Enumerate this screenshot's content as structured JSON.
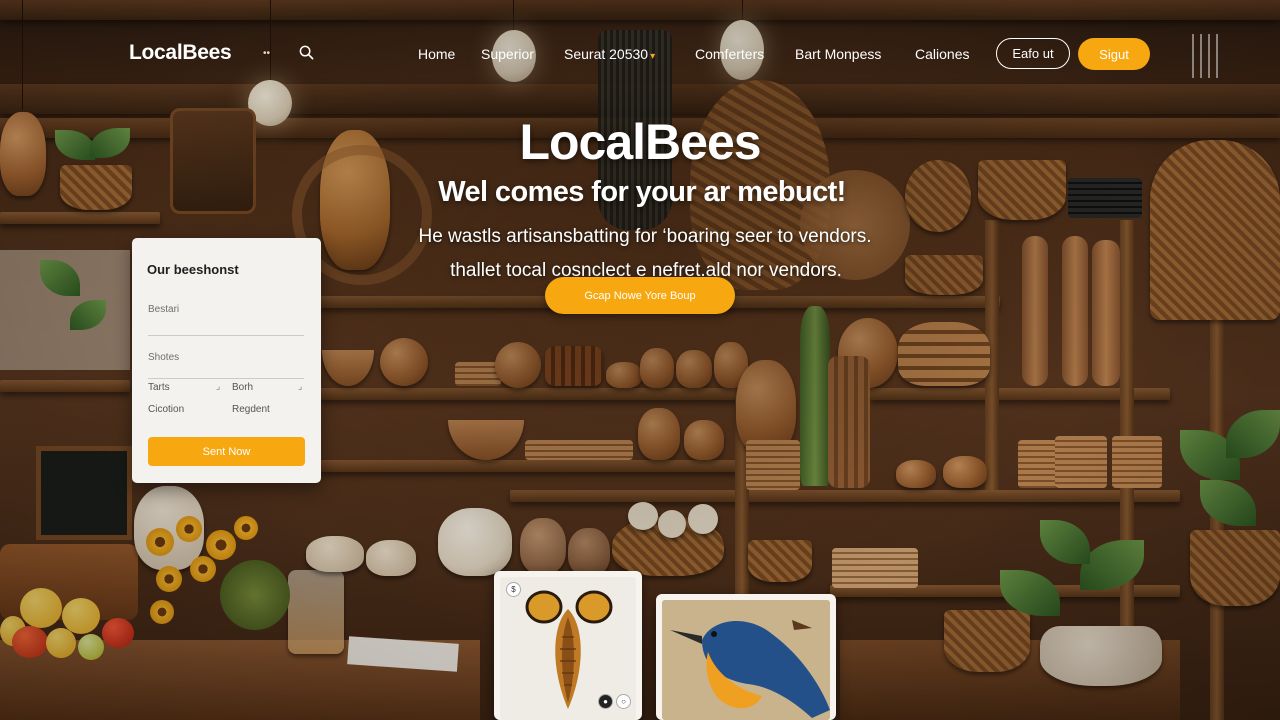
{
  "nav": {
    "logo": "LocalBees",
    "logo_dots": "••",
    "links": [
      "Home",
      "Superior",
      "Seurat 20530",
      "Comferters",
      "Bart Monpess",
      "Caliones"
    ],
    "login_label": "Eafo ut",
    "signup_label": "Sigut"
  },
  "hero": {
    "title": "LocalBees",
    "subtitle": "Wel comes for your ar mebuct!",
    "desc_line1": "He wastls artisansbatting for ‘boaring seer to vendors.",
    "desc_line2": "thallet tocal cosnclect e nefret.ald nor vendors.",
    "cta_label": "Gcap Nowe Yore Boup"
  },
  "search_card": {
    "title": "Our beeshonst",
    "field1": "Bestari",
    "field2": "Shotes",
    "select_left_label": "Tarts",
    "select_right_label": "Borh",
    "select_left_value": "Cicotion",
    "select_right_value": "Regdent",
    "button_label": "Sent Now"
  },
  "products": {
    "badge_top": "$",
    "colors": {
      "accent": "#f7a70f"
    }
  }
}
